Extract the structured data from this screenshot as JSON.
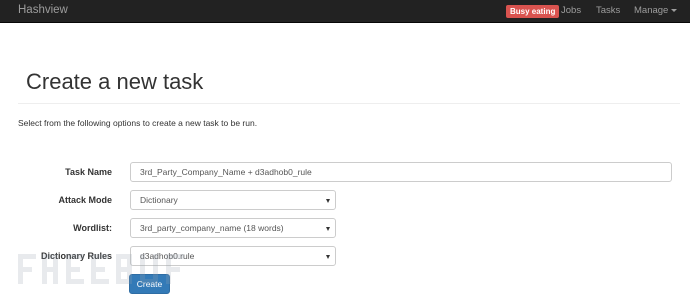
{
  "navbar": {
    "brand": "Hashview",
    "status_badge": "Busy eating",
    "links": {
      "jobs": "Jobs",
      "tasks": "Tasks",
      "manage": "Manage"
    }
  },
  "page": {
    "title": "Create a new task",
    "intro": "Select from the following options to create a new task to be run."
  },
  "form": {
    "task_name": {
      "label": "Task Name",
      "value": "3rd_Party_Company_Name + d3adhob0_rule"
    },
    "attack_mode": {
      "label": "Attack Mode",
      "selected": "Dictionary"
    },
    "wordlist": {
      "label": "Wordlist:",
      "selected": "3rd_party_company_name (18 words)"
    },
    "dictionary_rules": {
      "label": "Dictionary Rules",
      "selected": "d3adhob0.rule"
    },
    "submit_label": "Create"
  },
  "colors": {
    "navbar": "#222222",
    "badge": "#d9534f",
    "primary_button": "#337ab7"
  },
  "icons": {
    "select_arrow": "chevron-down-icon",
    "manage_caret": "caret-down-icon"
  }
}
